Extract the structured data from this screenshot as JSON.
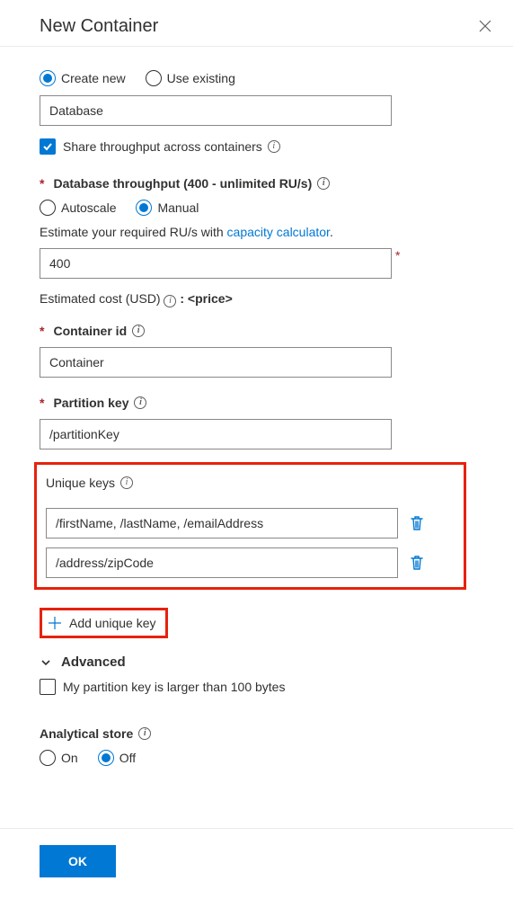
{
  "header": {
    "title": "New Container"
  },
  "mode_options": {
    "create_new": "Create new",
    "use_existing": "Use existing",
    "selected": "create_new"
  },
  "database_name_value": "Database",
  "share_throughput_label": "Share throughput across containers",
  "share_throughput_checked": true,
  "db_throughput": {
    "heading": "Database throughput (400 - unlimited RU/s)",
    "options": {
      "autoscale": "Autoscale",
      "manual": "Manual",
      "selected": "manual"
    },
    "estimate_pre": "Estimate your required RU/s with ",
    "estimate_link": "capacity calculator",
    "estimate_post": ".",
    "ru_value": "400",
    "cost_label_pre": "Estimated cost (USD) ",
    "cost_label_bold": ": <price>"
  },
  "container_id": {
    "label": "Container id",
    "value": "Container"
  },
  "partition_key": {
    "label": "Partition key",
    "value": "/partitionKey"
  },
  "unique_keys": {
    "label": "Unique keys",
    "items": [
      "/firstName, /lastName, /emailAddress",
      "/address/zipCode"
    ],
    "add_label": "Add unique key"
  },
  "advanced": {
    "title": "Advanced",
    "large_pk_label": "My partition key is larger than 100 bytes",
    "large_pk_checked": false
  },
  "analytical_store": {
    "label": "Analytical store",
    "options": {
      "on": "On",
      "off": "Off",
      "selected": "off"
    }
  },
  "footer": {
    "ok": "OK"
  }
}
